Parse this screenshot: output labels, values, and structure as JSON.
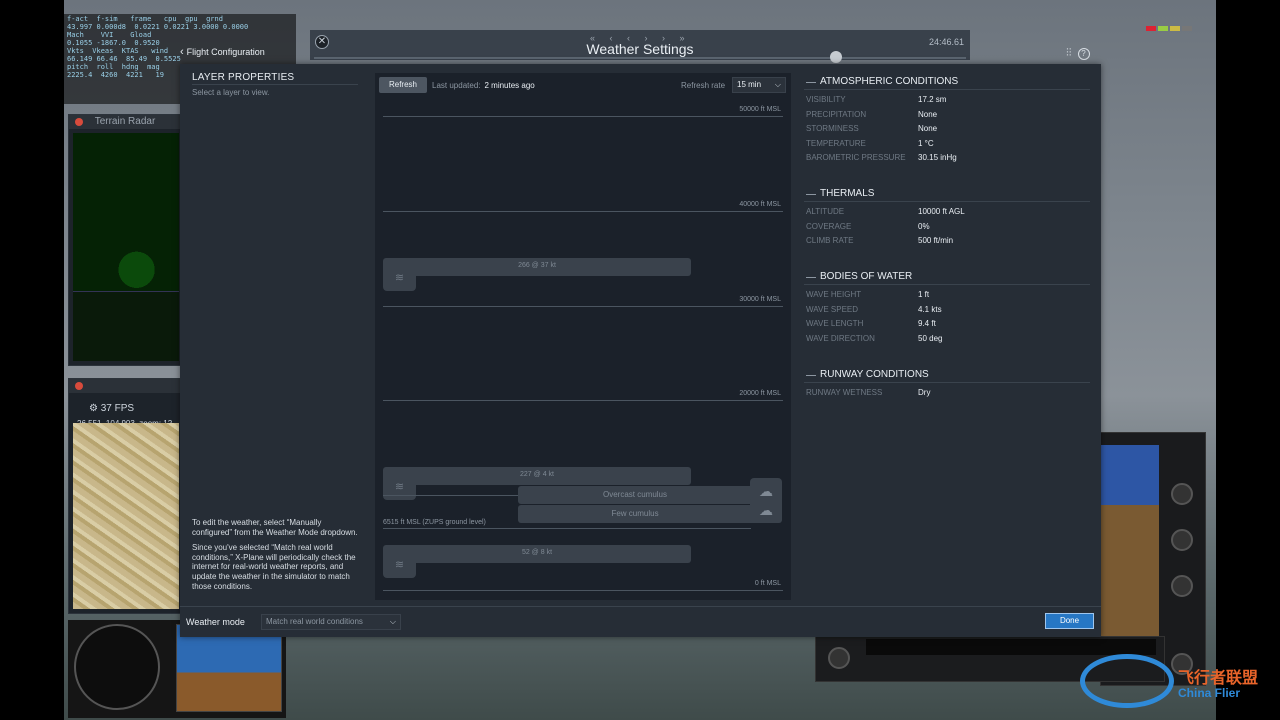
{
  "window": {
    "title": "Weather Settings",
    "time": "24:46.61",
    "nav_arrows": "« ‹ ‹ › › »"
  },
  "breadcrumb": {
    "back_label": "Flight Configuration"
  },
  "sim_overlays": {
    "terrain_radar_title": "Terrain Radar",
    "map_fps": "37 FPS",
    "map_coords": "26.551, 104.903, zoom: 12",
    "data_lines": [
      "f-act  f-sim   frame   cpu  gpu  grnd",
      "43.997 0.000d8  0.0221 0.0221 3.0000 0.0000",
      "Mach    VVI    Gload",
      "0.1055 -1867.0  0.9520",
      "Vkts  Vkeas  KTAS   wind",
      "66.149 66.46  85.49  0.5525",
      "pitch  roll  hdng  mag",
      "2225.4  4260  4221   19"
    ]
  },
  "layer_properties": {
    "title": "LAYER PROPERTIES",
    "hint": "Select a layer to view.",
    "info_1": "To edit the weather, select “Manually configured” from the Weather Mode dropdown.",
    "info_2": "Since you've selected “Match real world conditions,” X-Plane will periodically check the internet for real-world weather reports, and update the weather in the simulator to match those conditions."
  },
  "graph": {
    "refresh_label": "Refresh",
    "last_updated_label": "Last updated:",
    "last_updated_value": "2 minutes ago",
    "refresh_rate_label": "Refresh rate",
    "refresh_rate_value": "15 min",
    "altitude_lines": [
      {
        "label": "50000 ft MSL",
        "value_ft": 50000
      },
      {
        "label": "40000 ft MSL",
        "value_ft": 40000
      },
      {
        "label": "30000 ft MSL",
        "value_ft": 30000
      },
      {
        "label": "20000 ft MSL",
        "value_ft": 20000
      },
      {
        "label": "0 ft MSL",
        "value_ft": 0
      }
    ],
    "ground_level_label": "6515 ft MSL (ZUPS ground level)",
    "wind_layers": [
      {
        "label": "266 @ 37 kt"
      },
      {
        "label": "227 @ 4 kt"
      },
      {
        "label": "52 @ 8 kt"
      }
    ],
    "cloud_layers": [
      {
        "label": "Overcast cumulus"
      },
      {
        "label": "Few cumulus"
      }
    ]
  },
  "atmospheric": {
    "title": "ATMOSPHERIC CONDITIONS",
    "rows": [
      {
        "key": "VISIBILITY",
        "value": "17.2 sm"
      },
      {
        "key": "PRECIPITATION",
        "value": "None"
      },
      {
        "key": "STORMINESS",
        "value": "None"
      },
      {
        "key": "TEMPERATURE",
        "value": "1 °C"
      },
      {
        "key": "BAROMETRIC PRESSURE",
        "value": "30.15 inHg"
      }
    ]
  },
  "thermals": {
    "title": "THERMALS",
    "rows": [
      {
        "key": "ALTITUDE",
        "value": "10000 ft AGL"
      },
      {
        "key": "COVERAGE",
        "value": "0%"
      },
      {
        "key": "CLIMB RATE",
        "value": "500 ft/min"
      }
    ]
  },
  "water": {
    "title": "BODIES OF WATER",
    "rows": [
      {
        "key": "WAVE HEIGHT",
        "value": "1 ft"
      },
      {
        "key": "WAVE SPEED",
        "value": "4.1 kts"
      },
      {
        "key": "WAVE LENGTH",
        "value": "9.4 ft"
      },
      {
        "key": "WAVE DIRECTION",
        "value": "50 deg"
      }
    ]
  },
  "runway": {
    "title": "RUNWAY CONDITIONS",
    "rows": [
      {
        "key": "RUNWAY WETNESS",
        "value": "Dry"
      }
    ]
  },
  "footer": {
    "weather_mode_label": "Weather mode",
    "weather_mode_value": "Match real world conditions",
    "done_label": "Done"
  },
  "watermark": {
    "cn": "飞行者联盟",
    "en": "China Flier"
  },
  "colors": {
    "accent": "#2777c4",
    "dialog_bg": "#262d36",
    "graph_bg": "#1b212a"
  }
}
